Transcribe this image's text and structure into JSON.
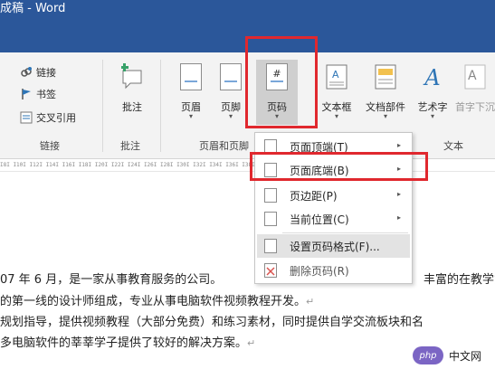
{
  "title": "成稿 - Word",
  "ribbon": {
    "links_group": {
      "link": "链接",
      "bookmark": "书签",
      "cross_ref": "交叉引用",
      "label": "链接"
    },
    "comment_group": {
      "comment": "批注",
      "label": "批注"
    },
    "header_footer_group": {
      "header": "页眉",
      "footer": "页脚",
      "page_number": "页码",
      "label": "页眉和页脚",
      "header_chev": "▾",
      "footer_chev": "▾",
      "page_number_chev": "▾"
    },
    "text_group": {
      "textbox": "文本框",
      "quick_parts": "文档部件",
      "wordart": "艺术字",
      "dropcap": "首字下沉",
      "label": "文本",
      "textbox_chev": "▾",
      "quick_parts_chev": "▾",
      "wordart_chev": "▾"
    }
  },
  "ruler": "I8I  I10I  I12I  I14I  I16I  I18I  I20I  I22I  I24I  I26I  I28I  I30I  I32I  I34I  I36I  I38I  I40I  I42I  I44",
  "menu": {
    "items": [
      {
        "label": "页面顶端(T)",
        "arrow": "▸"
      },
      {
        "label": "页面底端(B)",
        "arrow": "▸"
      },
      {
        "label": "页边距(P)",
        "arrow": "▸"
      },
      {
        "label": "当前位置(C)",
        "arrow": "▸"
      },
      {
        "label": "设置页码格式(F)..."
      },
      {
        "label": "删除页码(R)"
      }
    ]
  },
  "document": {
    "lines": [
      {
        "text": "07 年 6 月，是一家从事教育服务的公司。",
        "mark": ""
      },
      {
        "text": "丰富的在教学第",
        "mark": ""
      },
      {
        "text": "的第一线的设计师组成，专业从事电脑软件视频教程开发。",
        "mark": "↵"
      },
      {
        "text": "规划指导，提供视频教程（大部分免费）和练习素材，同时提供自学交流板块和名",
        "mark": ""
      },
      {
        "text": "多电脑软件的莘莘学子提供了较好的解决方案。",
        "mark": "↵"
      }
    ]
  },
  "watermark": {
    "logo": "php",
    "text": "中文网"
  },
  "colors": {
    "title_bar": "#2b579a",
    "highlight_border": "#e0282e"
  }
}
